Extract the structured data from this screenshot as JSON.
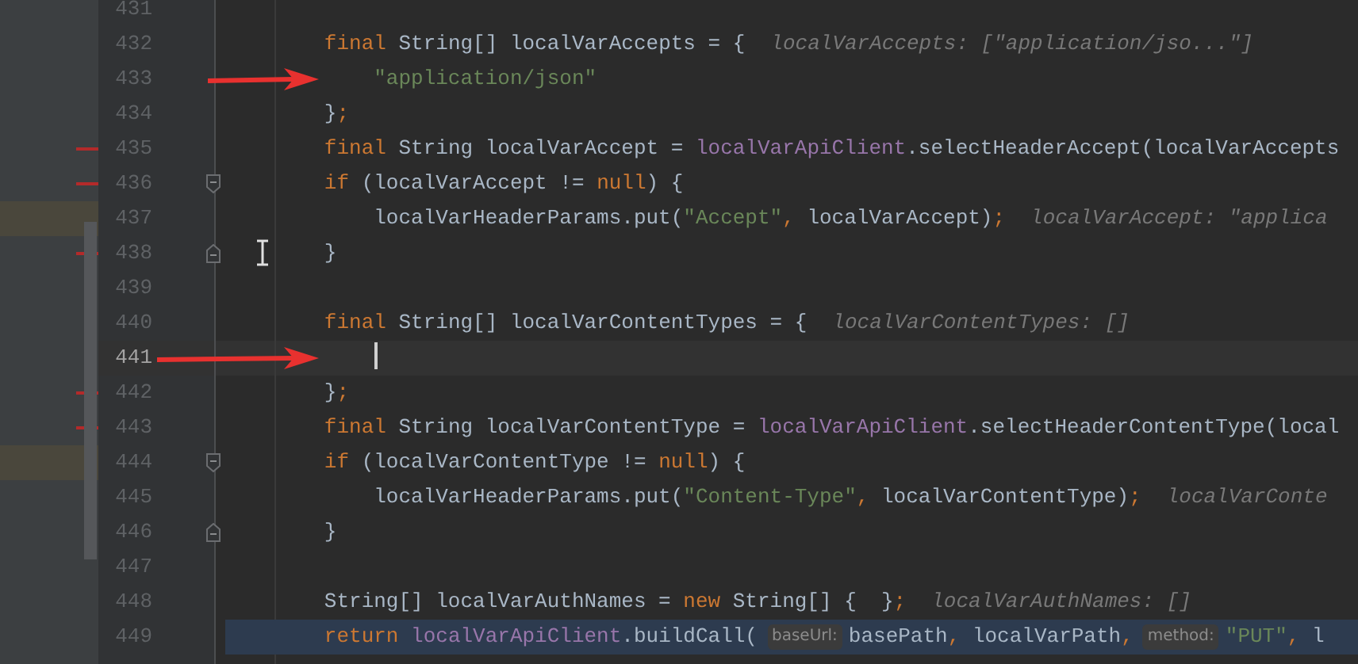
{
  "editor": {
    "lines": [
      {
        "number": "431"
      },
      {
        "number": "432",
        "tokens": [
          {
            "kind": "kw",
            "text": "final"
          },
          {
            "kind": "plain",
            "text": " String[] localVarAccepts = {"
          },
          {
            "kind": "hint",
            "text": "localVarAccepts: [\"application/jso...\"]"
          }
        ]
      },
      {
        "number": "433",
        "arrow": true,
        "nested": true,
        "tokens": [
          {
            "kind": "str",
            "text": "\"application/json\""
          }
        ]
      },
      {
        "number": "434",
        "tokens": [
          {
            "kind": "plain",
            "text": "}"
          },
          {
            "kind": "kw",
            "text": ";"
          }
        ]
      },
      {
        "number": "435",
        "changed": true,
        "tokens": [
          {
            "kind": "kw",
            "text": "final"
          },
          {
            "kind": "plain",
            "text": " String localVarAccept = "
          },
          {
            "kind": "field",
            "text": "localVarApiClient"
          },
          {
            "kind": "plain",
            "text": ".selectHeaderAccept(localVarAccepts"
          }
        ]
      },
      {
        "number": "436",
        "changed": true,
        "fold_start": true,
        "tokens": [
          {
            "kind": "kw",
            "text": "if"
          },
          {
            "kind": "plain",
            "text": " (localVarAccept != "
          },
          {
            "kind": "kw",
            "text": "null"
          },
          {
            "kind": "plain",
            "text": ") {"
          }
        ]
      },
      {
        "number": "437",
        "band": true,
        "nested": true,
        "tokens": [
          {
            "kind": "plain",
            "text": "localVarHeaderParams.put("
          },
          {
            "kind": "str",
            "text": "\"Accept\""
          },
          {
            "kind": "kw",
            "text": ","
          },
          {
            "kind": "plain",
            "text": " localVarAccept)"
          },
          {
            "kind": "kw",
            "text": ";"
          },
          {
            "kind": "hint",
            "text": "localVarAccept: \"applica"
          }
        ]
      },
      {
        "number": "438",
        "changed": true,
        "fold_end": true,
        "pointer": true,
        "tokens": [
          {
            "kind": "plain",
            "text": "}"
          }
        ]
      },
      {
        "number": "439"
      },
      {
        "number": "440",
        "tokens": [
          {
            "kind": "kw",
            "text": "final"
          },
          {
            "kind": "plain",
            "text": " String[] localVarContentTypes = {"
          },
          {
            "kind": "hint",
            "text": "localVarContentTypes: []"
          }
        ]
      },
      {
        "number": "441",
        "current": true,
        "caret": true,
        "arrow": true,
        "nested": true
      },
      {
        "number": "442",
        "changed": true,
        "tokens": [
          {
            "kind": "plain",
            "text": "}"
          },
          {
            "kind": "kw",
            "text": ";"
          }
        ]
      },
      {
        "number": "443",
        "changed": true,
        "tokens": [
          {
            "kind": "kw",
            "text": "final"
          },
          {
            "kind": "plain",
            "text": " String localVarContentType = "
          },
          {
            "kind": "field",
            "text": "localVarApiClient"
          },
          {
            "kind": "plain",
            "text": ".selectHeaderContentType(local"
          }
        ]
      },
      {
        "number": "444",
        "band": true,
        "fold_start": true,
        "tokens": [
          {
            "kind": "kw",
            "text": "if"
          },
          {
            "kind": "plain",
            "text": " (localVarContentType != "
          },
          {
            "kind": "kw",
            "text": "null"
          },
          {
            "kind": "plain",
            "text": ") {"
          }
        ]
      },
      {
        "number": "445",
        "nested": true,
        "tokens": [
          {
            "kind": "plain",
            "text": "localVarHeaderParams.put("
          },
          {
            "kind": "str",
            "text": "\"Content-Type\""
          },
          {
            "kind": "kw",
            "text": ","
          },
          {
            "kind": "plain",
            "text": " localVarContentType)"
          },
          {
            "kind": "kw",
            "text": ";"
          },
          {
            "kind": "hint",
            "text": "localVarConte"
          }
        ]
      },
      {
        "number": "446",
        "fold_end": true,
        "tokens": [
          {
            "kind": "plain",
            "text": "}"
          }
        ]
      },
      {
        "number": "447"
      },
      {
        "number": "448",
        "tokens": [
          {
            "kind": "plain",
            "text": "String[] localVarAuthNames = "
          },
          {
            "kind": "kw",
            "text": "new"
          },
          {
            "kind": "plain",
            "text": " String[] {  }"
          },
          {
            "kind": "kw",
            "text": ";"
          },
          {
            "kind": "hint",
            "text": "localVarAuthNames: []"
          }
        ]
      },
      {
        "number": "449",
        "highlighted": true,
        "tokens": [
          {
            "kind": "kw",
            "text": "return"
          },
          {
            "kind": "field",
            "text": " localVarApiClient"
          },
          {
            "kind": "plain",
            "text": ".buildCall("
          },
          {
            "kind": "param",
            "text": "baseUrl:"
          },
          {
            "kind": "plain",
            "text": "basePath"
          },
          {
            "kind": "kw",
            "text": ","
          },
          {
            "kind": "plain",
            "text": " localVarPath"
          },
          {
            "kind": "kw",
            "text": ","
          },
          {
            "kind": "param",
            "text": "method:"
          },
          {
            "kind": "str",
            "text": "\"PUT\""
          },
          {
            "kind": "kw",
            "text": ","
          },
          {
            "kind": "plain",
            "text": " l"
          }
        ]
      }
    ]
  }
}
